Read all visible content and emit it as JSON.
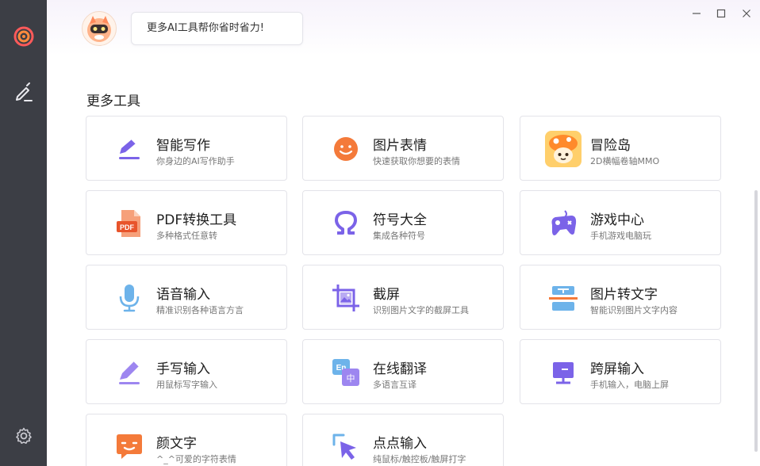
{
  "header": {
    "bubble_text": "更多AI工具帮你省时省力!"
  },
  "section": {
    "title": "更多工具"
  },
  "cards": [
    {
      "name": "智能写作",
      "desc": "你身边的AI写作助手"
    },
    {
      "name": "图片表情",
      "desc": "快速获取你想要的表情"
    },
    {
      "name": "冒险岛",
      "desc": "2D横幅卷轴MMO"
    },
    {
      "name": "PDF转换工具",
      "desc": "多种格式任意转"
    },
    {
      "name": "符号大全",
      "desc": "集成各种符号"
    },
    {
      "name": "游戏中心",
      "desc": "手机游戏电脑玩"
    },
    {
      "name": "语音输入",
      "desc": "精准识别各种语言方言"
    },
    {
      "name": "截屏",
      "desc": "识别图片文字的截屏工具"
    },
    {
      "name": "图片转文字",
      "desc": "智能识别图片文字内容"
    },
    {
      "name": "手写输入",
      "desc": "用鼠标写字输入"
    },
    {
      "name": "在线翻译",
      "desc": "多语言互译"
    },
    {
      "name": "跨屏输入",
      "desc": "手机输入，电脑上屏"
    },
    {
      "name": "颜文字",
      "desc": "^_^可爱的字符表情"
    },
    {
      "name": "点点输入",
      "desc": "纯鼠标/触控板/触屏打字"
    }
  ],
  "icon_labels": {
    "pdf": "PDF",
    "translate_en": "En",
    "translate_zh": "中"
  },
  "colors": {
    "accent": "#7b63e8",
    "orange": "#f47a3a",
    "rail_bg": "#3c3e45",
    "logo_ring": "#ff5a5a"
  }
}
